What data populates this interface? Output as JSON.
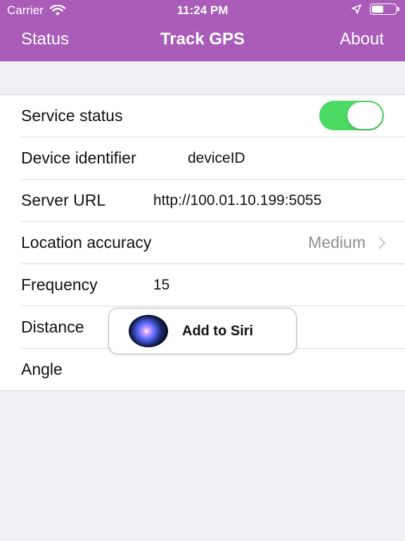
{
  "status_bar": {
    "carrier": "Carrier",
    "time": "11:24 PM",
    "battery_level": 0.55
  },
  "nav": {
    "left": "Status",
    "title": "Track GPS",
    "right": "About"
  },
  "rows": {
    "service_status": {
      "label": "Service status",
      "on": true
    },
    "device_identifier": {
      "label": "Device identifier",
      "value": "deviceID"
    },
    "server_url": {
      "label": "Server URL",
      "value": "http://100.01.10.199:5055"
    },
    "location_accuracy": {
      "label": "Location accuracy",
      "value": "Medium"
    },
    "frequency": {
      "label": "Frequency",
      "value": "15"
    },
    "distance": {
      "label": "Distance"
    },
    "angle": {
      "label": "Angle"
    }
  },
  "siri_button": {
    "label": "Add to Siri"
  },
  "colors": {
    "accent": "#a95cb8",
    "switch_on": "#4cd964"
  }
}
